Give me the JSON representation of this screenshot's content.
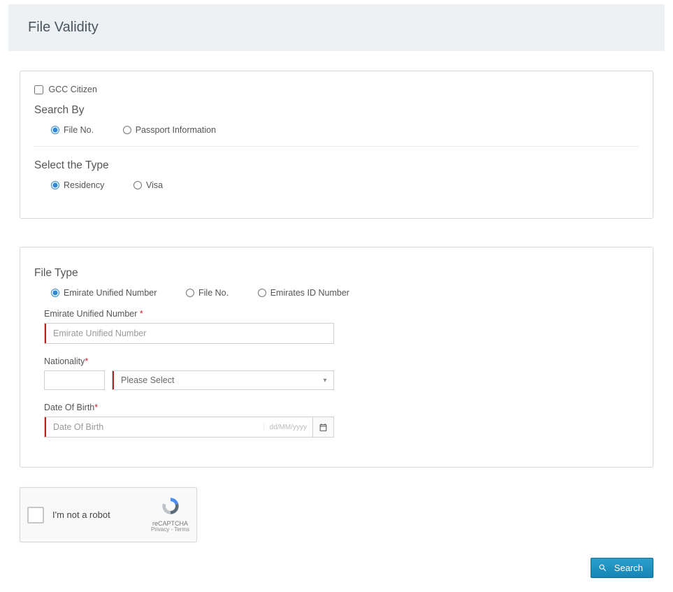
{
  "header": {
    "title": "File Validity"
  },
  "gcc": {
    "label": "GCC Citizen"
  },
  "searchBy": {
    "title": "Search By",
    "options": {
      "file_no": "File No.",
      "passport": "Passport Information"
    }
  },
  "selectType": {
    "title": "Select the Type",
    "options": {
      "residency": "Residency",
      "visa": "Visa"
    }
  },
  "fileType": {
    "title": "File Type",
    "options": {
      "eun": "Emirate Unified Number",
      "file_no": "File No.",
      "eid": "Emirates ID Number"
    }
  },
  "fields": {
    "eun": {
      "label": "Emirate Unified Number ",
      "placeholder": "Emirate Unified Number"
    },
    "nationality": {
      "label": "Nationality",
      "placeholder_select": "Please Select"
    },
    "dob": {
      "label": "Date Of Birth",
      "placeholder": "Date Of Birth",
      "format": "dd/MM/yyyy"
    }
  },
  "recaptcha": {
    "label": "I'm not a robot",
    "brand": "reCAPTCHA",
    "links": "Privacy - Terms"
  },
  "buttons": {
    "search": "Search"
  },
  "asterisk": "*"
}
